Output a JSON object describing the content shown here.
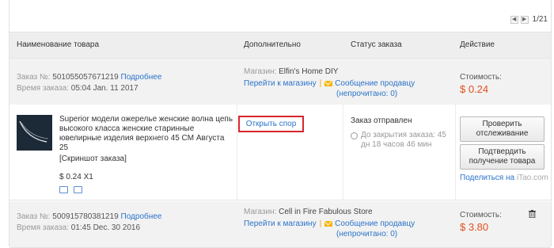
{
  "pagination": {
    "prev_icon": "chevron-left-icon",
    "next_icon": "chevron-right-icon",
    "text": "1/21"
  },
  "columns": {
    "product": "Наименование товара",
    "additional": "Дополнительно",
    "status": "Статус заказа",
    "action": "Действие"
  },
  "orders": [
    {
      "order_label": "Заказ №:",
      "order_number": "501055057671219",
      "details_link": "Подробнее",
      "time_label": "Время заказа:",
      "time_value": "05:04 Jan. 11 2017",
      "store_label": "Магазин:",
      "store_name": "Elfin's Home DIY",
      "goto_store": "Перейти к магазину",
      "message_seller": "Сообщение продавцу",
      "unread": "(непрочитано: 0)",
      "cost_label": "Стоимость:",
      "cost_value": "$ 0.24",
      "item": {
        "title": "Superior модели ожерелье женские волна цепь высокого класса женские старинные ювелирные изделия верхнего 45 CM Августа 25",
        "screenshot_link": "[Скриншот заказа]",
        "price": "$ 0.24 X1",
        "dispute_button": "Открыть спор",
        "status": "Заказ отправлен",
        "timer": "До закрытия заказа: 45 дн 18 часов 46 мин",
        "confirm_tracking": "Проверить отслеживание",
        "confirm_receipt": "Подтвердить получение товара",
        "share_text": "Поделиться на",
        "share_site": "iTao.com"
      }
    },
    {
      "order_label": "Заказ №:",
      "order_number": "500915780381219",
      "details_link": "Подробнее",
      "time_label": "Время заказа:",
      "time_value": "01:45 Dec. 30 2016",
      "store_label": "Магазин:",
      "store_name": "Cell in Fire Fabulous Store",
      "goto_store": "Перейти к магазину",
      "message_seller": "Сообщение продавцу",
      "unread": "(непрочитано: 0)",
      "cost_label": "Стоимость:",
      "cost_value": "$ 3.80",
      "delete_icon": "trash-icon"
    }
  ],
  "colors": {
    "accent_link": "#2b73c9",
    "price": "#e0501e",
    "highlight_border": "#d8262e",
    "separator": "#f2a000"
  }
}
